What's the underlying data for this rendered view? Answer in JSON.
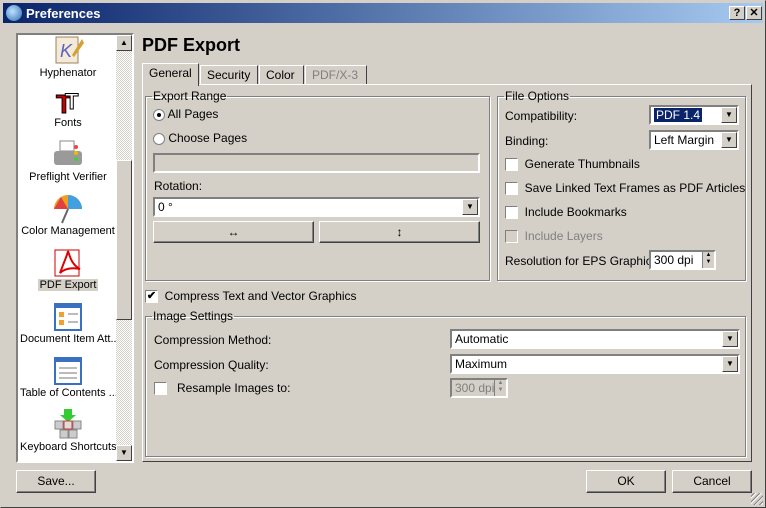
{
  "window": {
    "title": "Preferences",
    "help_label": "?",
    "close_label": "✕"
  },
  "sidebar": {
    "items": [
      {
        "label": "Hyphenator",
        "icon": "hyphenator-icon"
      },
      {
        "label": "Fonts",
        "icon": "fonts-icon"
      },
      {
        "label": "Preflight Verifier",
        "icon": "printer-icon"
      },
      {
        "label": "Color Management",
        "icon": "umbrella-icon"
      },
      {
        "label": "PDF Export",
        "icon": "pdf-icon",
        "selected": true
      },
      {
        "label": "Document Item Att...",
        "icon": "document-item-icon"
      },
      {
        "label": "Table of Contents ...",
        "icon": "table-of-contents-icon"
      },
      {
        "label": "Keyboard Shortcuts",
        "icon": "keyboard-icon"
      }
    ]
  },
  "page": {
    "title": "PDF Export"
  },
  "tabs": [
    {
      "label": "General"
    },
    {
      "label": "Security"
    },
    {
      "label": "Color"
    },
    {
      "label": "PDF/X-3"
    }
  ],
  "export_range": {
    "legend": "Export Range",
    "all_pages": "All Pages",
    "choose_pages": "Choose Pages",
    "pages_value": "",
    "rotation_label": "Rotation:",
    "rotation_value": "0 °",
    "flip_h": "↔",
    "flip_v": "↕"
  },
  "file_options": {
    "legend": "File Options",
    "compat_label": "Compatibility:",
    "compat_value": "PDF 1.4",
    "binding_label": "Binding:",
    "binding_value": "Left Margin",
    "thumbnails": "Generate Thumbnails",
    "linked": "Save Linked Text Frames as PDF Articles",
    "bookmarks": "Include Bookmarks",
    "layers": "Include Layers",
    "resolution_label": "Resolution for EPS Graphics:",
    "resolution_value": "300 dpi"
  },
  "compress": {
    "label": "Compress Text and Vector Graphics",
    "checked": true,
    "mark": "✔"
  },
  "image_settings": {
    "legend": "Image Settings",
    "method_label": "Compression Method:",
    "method_value": "Automatic",
    "quality_label": "Compression Quality:",
    "quality_value": "Maximum",
    "resample_label": "Resample Images to:",
    "resample_value": "300 dpi"
  },
  "buttons": {
    "save": "Save...",
    "ok": "OK",
    "cancel": "Cancel"
  }
}
